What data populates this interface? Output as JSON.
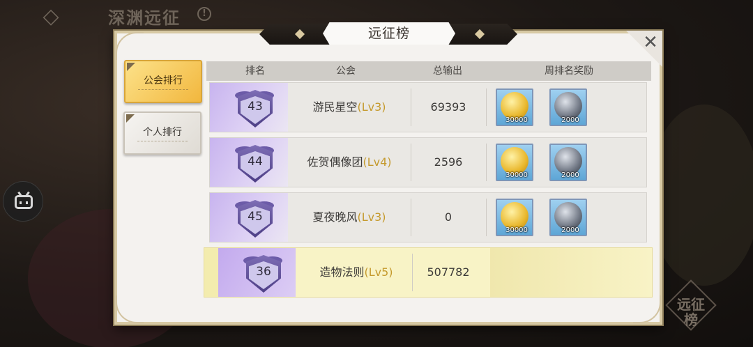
{
  "background": {
    "title": "深渊远征",
    "info_glyph": "!",
    "emblem_text": "远征榜"
  },
  "panel": {
    "title": "远征榜",
    "close_glyph": "✕"
  },
  "tabs": [
    {
      "label": "公会排行",
      "active": true
    },
    {
      "label": "个人排行",
      "active": false
    }
  ],
  "table": {
    "headers": [
      "排名",
      "公会",
      "总输出",
      "周排名奖励"
    ],
    "rows": [
      {
        "rank": "43",
        "name": "游民星空",
        "level": "(Lv3)",
        "damage": "69393",
        "rewards": [
          {
            "type": "gold-coin",
            "qty": "30000"
          },
          {
            "type": "silver-coin",
            "qty": "2000"
          }
        ]
      },
      {
        "rank": "44",
        "name": "佐贺偶像团",
        "level": "(Lv4)",
        "damage": "2596",
        "rewards": [
          {
            "type": "gold-coin",
            "qty": "30000"
          },
          {
            "type": "silver-coin",
            "qty": "2000"
          }
        ]
      },
      {
        "rank": "45",
        "name": "夏夜晚风",
        "level": "(Lv3)",
        "damage": "0",
        "rewards": [
          {
            "type": "gold-coin",
            "qty": "30000"
          },
          {
            "type": "silver-coin",
            "qty": "2000"
          }
        ]
      }
    ],
    "my_guild": {
      "rank": "36",
      "name": "造物法则",
      "level": "(Lv5)",
      "damage": "507782"
    }
  },
  "colors": {
    "accent_gold": "#f2b73e",
    "level_text": "#c59a2d",
    "rank_purple": "#c8b4ef",
    "my_row": "#f8f3c6"
  }
}
